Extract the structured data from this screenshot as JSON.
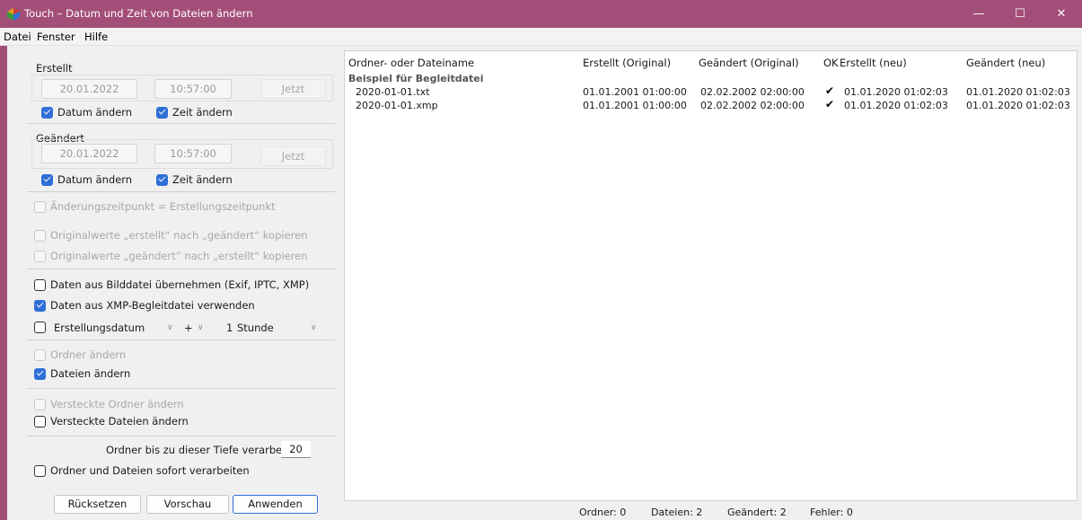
{
  "window": {
    "title": "Touch – Datum und Zeit von Dateien ändern",
    "minimize": "—",
    "maximize": "☐",
    "close": "✕"
  },
  "menu": [
    "Datei",
    "Fenster",
    "Hilfe"
  ],
  "created": {
    "label": "Erstellt",
    "date": "20.01.2022",
    "time": "10:57:00",
    "now": "Jetzt",
    "change_date": "Datum ändern",
    "change_time": "Zeit ändern"
  },
  "modified": {
    "label": "Geändert",
    "date": "20.01.2022",
    "time": "10:57:00",
    "now": "Jetzt",
    "change_date": "Datum ändern",
    "change_time": "Zeit ändern"
  },
  "options": {
    "mod_eq_created": "Änderungszeitpunkt = Erstellungszeitpunkt",
    "copy_created_to_mod": "Originalwerte „erstellt“ nach „geändert“ kopieren",
    "copy_mod_to_created": "Originalwerte „geändert“ nach „erstellt“ kopieren",
    "from_image": "Daten aus Bilddatei übernehmen (Exif, IPTC, XMP)",
    "from_xmp": "Daten aus XMP-Begleitdatei verwenden",
    "offset_field": "Erstellungsdatum",
    "offset_sign": "+",
    "offset_amount": "1",
    "offset_unit": "Stunde",
    "change_folders": "Ordner ändern",
    "change_files": "Dateien ändern",
    "hidden_folders": "Versteckte Ordner ändern",
    "hidden_files": "Versteckte Dateien ändern",
    "depth_label": "Ordner bis zu dieser Tiefe verarbeiten:",
    "depth_value": "20",
    "process_immediately": "Ordner und Dateien sofort verarbeiten"
  },
  "buttons": {
    "reset": "Rücksetzen",
    "preview": "Vorschau",
    "apply": "Anwenden"
  },
  "table": {
    "columns": [
      "Ordner- oder Dateiname",
      "Erstellt (Original)",
      "Geändert (Original)",
      "OK",
      "Erstellt (neu)",
      "Geändert (neu)"
    ],
    "group": "Beispiel für Begleitdatei",
    "rows": [
      {
        "name": "2020-01-01.txt",
        "created_orig": "01.01.2001  01:00:00",
        "modified_orig": "02.02.2002  02:00:00",
        "ok": "✔",
        "created_new": "01.01.2020  01:02:03",
        "modified_new": "01.01.2020  01:02:03"
      },
      {
        "name": "2020-01-01.xmp",
        "created_orig": "01.01.2001  01:00:00",
        "modified_orig": "02.02.2002  02:00:00",
        "ok": "✔",
        "created_new": "01.01.2020  01:02:03",
        "modified_new": "01.01.2020  01:02:03"
      }
    ]
  },
  "status": {
    "folders": "Ordner: 0",
    "files": "Dateien: 2",
    "changed": "Geändert: 2",
    "errors": "Fehler: 0"
  },
  "colors": {
    "titlebar": "#a34e78",
    "accent": "#2f6fd6"
  }
}
